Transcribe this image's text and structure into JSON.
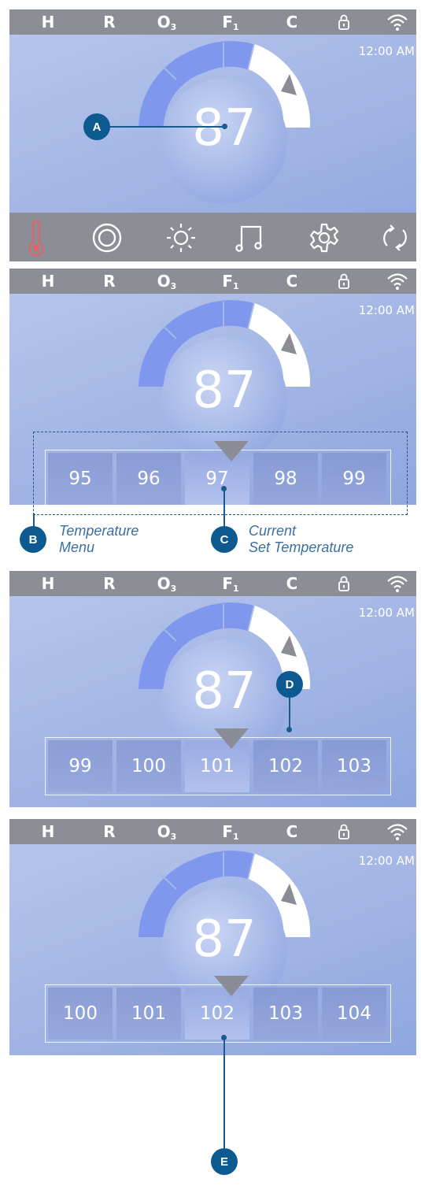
{
  "status_bar": {
    "heat": "H",
    "recirc": "R",
    "ozone": "O",
    "ozone_sub": "3",
    "filter": "F",
    "filter_sub": "1",
    "clean": "C",
    "icons": [
      "lock-icon",
      "wifi-icon"
    ]
  },
  "clock": "12:00 AM",
  "current_temperature": "87",
  "bottom_bar": {
    "icons": [
      "thermometer-icon",
      "jets-icon",
      "light-icon",
      "music-icon",
      "settings-icon",
      "cycle-icon"
    ]
  },
  "screens": [
    {
      "label": "A"
    },
    {
      "label_b": "B",
      "label_c": "C",
      "menu": [
        "95",
        "96",
        "97",
        "98",
        "99"
      ],
      "selected": "97"
    },
    {
      "label": "D",
      "menu": [
        "99",
        "100",
        "101",
        "102",
        "103"
      ],
      "selected": "101"
    },
    {
      "label": "E",
      "menu": [
        "100",
        "101",
        "102",
        "103",
        "104"
      ],
      "selected": "102"
    }
  ],
  "captions": {
    "temperature_menu_line1": "Temperature",
    "temperature_menu_line2": "Menu",
    "current_set_line1": "Current",
    "current_set_line2": "Set Temperature"
  },
  "colors": {
    "status_bar": "#8c8e95",
    "screen_bg": "#a6b8e6",
    "gauge_blue": "#7f98ee",
    "callout": "#0d5a90",
    "thermometer": "#e0626b"
  }
}
